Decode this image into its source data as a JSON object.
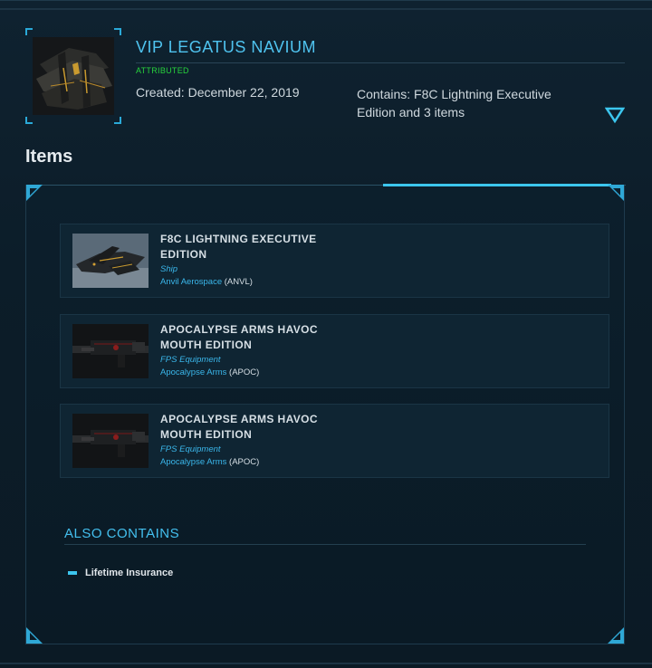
{
  "package": {
    "title": "VIP LEGATUS NAVIUM",
    "status": "ATTRIBUTED",
    "created": "Created: December 22, 2019",
    "contains": "Contains: F8C Lightning Executive Edition and 3 items"
  },
  "items_section": {
    "heading": "Items",
    "items": [
      {
        "name": "F8C LIGHTNING EXECUTIVE EDITION",
        "type": "Ship",
        "manufacturer": "Anvil Aerospace",
        "manufacturer_code": "(ANVL)",
        "image": "ship"
      },
      {
        "name": "APOCALYPSE ARMS HAVOC MOUTH EDITION",
        "type": "FPS Equipment",
        "manufacturer": "Apocalypse Arms",
        "manufacturer_code": "(APOC)",
        "image": "weapon"
      },
      {
        "name": "APOCALYPSE ARMS HAVOC MOUTH EDITION",
        "type": "FPS Equipment",
        "manufacturer": "Apocalypse Arms",
        "manufacturer_code": "(APOC)",
        "image": "weapon"
      }
    ]
  },
  "also_contains": {
    "heading": "ALSO CONTAINS",
    "items": [
      "Lifetime Insurance"
    ]
  },
  "colors": {
    "accent": "#3cc6ee",
    "title": "#4fc3ef",
    "status_green": "#27d33c",
    "background": "#0c1d29"
  },
  "icons": {
    "expand": "triangle-down-icon",
    "bullet": "dash-bullet-icon"
  }
}
